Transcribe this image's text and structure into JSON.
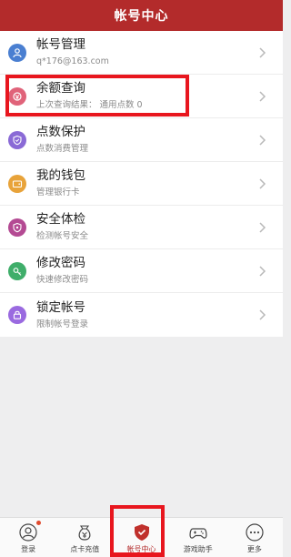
{
  "header": {
    "title": "帐号中心"
  },
  "menu": [
    {
      "title": "帐号管理",
      "subtitle": "q*176@163.com",
      "icon": "user-icon",
      "color": "#4a7fd1"
    },
    {
      "title": "余额查询",
      "subtitle": "上次查询结果：  通用点数 0",
      "icon": "coin-icon",
      "color": "#e0637a"
    },
    {
      "title": "点数保护",
      "subtitle": "点数消费管理",
      "icon": "shield-icon",
      "color": "#8a6ad6"
    },
    {
      "title": "我的钱包",
      "subtitle": "管理银行卡",
      "icon": "wallet-icon",
      "color": "#e8a33a"
    },
    {
      "title": "安全体检",
      "subtitle": "检测帐号安全",
      "icon": "security-check-icon",
      "color": "#b44a93"
    },
    {
      "title": "修改密码",
      "subtitle": "快速修改密码",
      "icon": "key-icon",
      "color": "#3fae6a"
    },
    {
      "title": "锁定帐号",
      "subtitle": "限制帐号登录",
      "icon": "lock-icon",
      "color": "#9a6ae0"
    }
  ],
  "tabs": [
    {
      "label": "登录",
      "icon": "user-login-icon"
    },
    {
      "label": "点卡充值",
      "icon": "card-recharge-icon"
    },
    {
      "label": "帐号中心",
      "icon": "shield-check-icon"
    },
    {
      "label": "游戏助手",
      "icon": "gamepad-icon"
    },
    {
      "label": "更多",
      "icon": "more-icon"
    }
  ],
  "colors": {
    "header": "#b32b2b",
    "highlight": "#e8161e"
  }
}
